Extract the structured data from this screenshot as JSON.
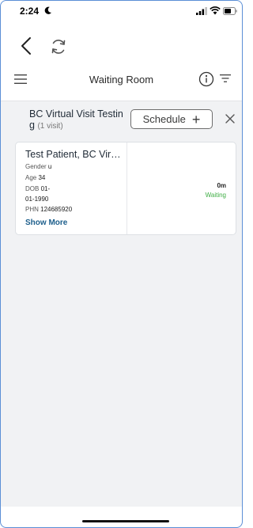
{
  "status_bar": {
    "time": "2:24",
    "icons": [
      "moon-icon",
      "signal-icon",
      "wifi-icon",
      "battery-icon"
    ]
  },
  "nav": {
    "icons": [
      "chevron-left-icon",
      "refresh-icon"
    ]
  },
  "header": {
    "title": "Waiting Room",
    "icons": [
      "hamburger-menu-icon",
      "info-icon",
      "filter-icon"
    ]
  },
  "group": {
    "name": "BC Virtual Visit Testing",
    "visit_count": "(1 visit)",
    "schedule_label": "Schedule",
    "schedule_icon": "+"
  },
  "patient": {
    "name": "Test Patient, BC Virtual",
    "gender_label": "Gender",
    "gender": "u",
    "age_label": "Age",
    "age": "34",
    "dob_label": "DOB",
    "dob_part1": "01-",
    "dob_part2": "01-1990",
    "phn_label": "PHN",
    "phn": "124685920",
    "show_more": "Show More",
    "wait_time": "0m",
    "status": "Waiting"
  },
  "colors": {
    "frame_border": "#5b8fd6",
    "content_bg": "#f1f2f4",
    "link": "#1d5f8c",
    "waiting_green": "#3fae45"
  }
}
